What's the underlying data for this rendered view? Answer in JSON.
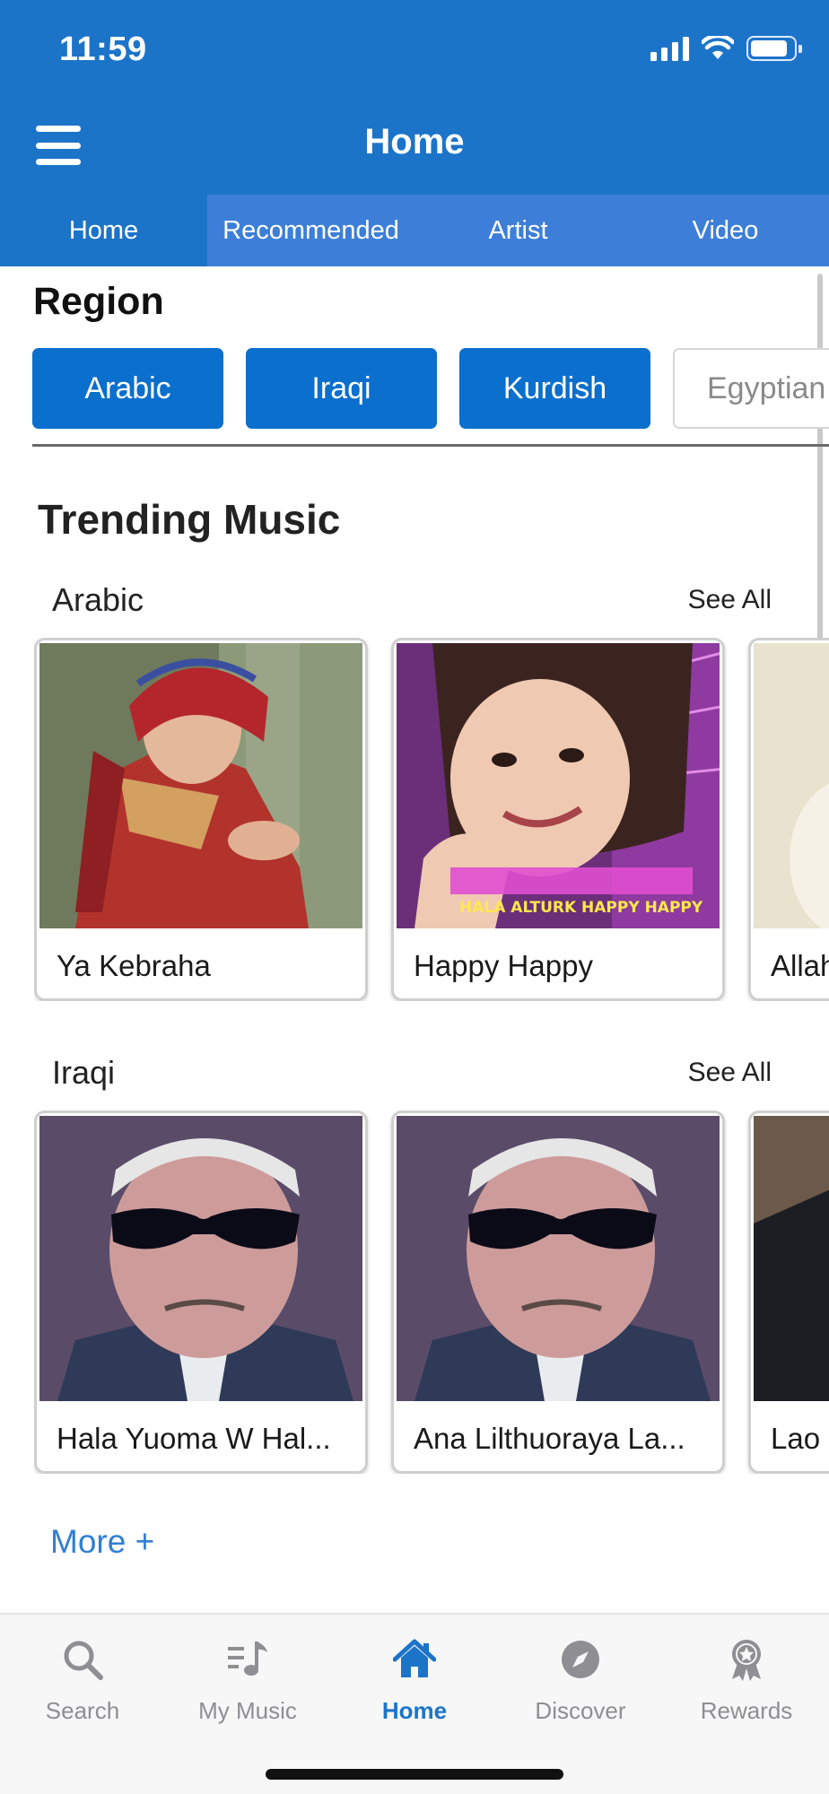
{
  "status_bar": {
    "time": "11:59"
  },
  "header": {
    "title": "Home"
  },
  "tabs": [
    {
      "label": "Home",
      "active": true
    },
    {
      "label": "Recommended",
      "active": false
    },
    {
      "label": "Artist",
      "active": false
    },
    {
      "label": "Video",
      "active": false
    }
  ],
  "region": {
    "title": "Region",
    "chips": [
      {
        "label": "Arabic",
        "selected": true
      },
      {
        "label": "Iraqi",
        "selected": true
      },
      {
        "label": "Kurdish",
        "selected": true
      },
      {
        "label": "Egyptian",
        "selected": false
      }
    ]
  },
  "trending": {
    "title": "Trending Music",
    "sections": [
      {
        "title": "Arabic",
        "see_all": "See All",
        "items": [
          {
            "title": "Ya Kebraha"
          },
          {
            "title": "Happy Happy",
            "cover_text": "HALA ALTURK HAPPY HAPPY"
          },
          {
            "title": "Allah"
          }
        ]
      },
      {
        "title": "Iraqi",
        "see_all": "See All",
        "items": [
          {
            "title": "Hala Yuoma W Hal..."
          },
          {
            "title": "Ana Lilthuoraya La..."
          },
          {
            "title": "Lao"
          }
        ]
      }
    ],
    "more": "More +"
  },
  "bottom_nav": [
    {
      "label": "Search",
      "icon": "search-icon",
      "active": false
    },
    {
      "label": "My Music",
      "icon": "music-list-icon",
      "active": false
    },
    {
      "label": "Home",
      "icon": "home-icon",
      "active": true
    },
    {
      "label": "Discover",
      "icon": "compass-icon",
      "active": false
    },
    {
      "label": "Rewards",
      "icon": "award-icon",
      "active": false
    }
  ],
  "colors": {
    "primary": "#1c74c9",
    "tab_bar": "#3d7fd8",
    "chip_selected": "#0a6fcd",
    "nav_inactive": "#8e8e93",
    "link": "#2f7fd4"
  }
}
